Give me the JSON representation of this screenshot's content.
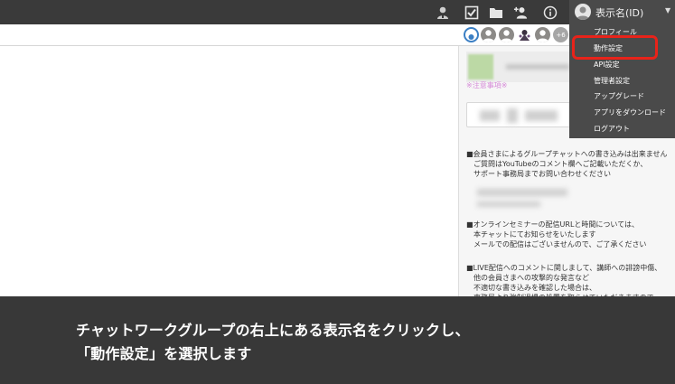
{
  "topbar": {
    "icons": [
      "admin-icon",
      "task-icon",
      "folder-icon",
      "add-contact-icon",
      "info-icon"
    ],
    "user": {
      "name": "表示名(ID)"
    }
  },
  "room": {
    "member_more": "+6"
  },
  "right_panel": {
    "notice": "※注意事項※",
    "para1": [
      "■会員さまによるグループチャットへの書き込みは出来ません",
      "　ご質問はYouTubeのコメント欄へご記載いただくか、",
      "　サポート事務局までお問い合わせください"
    ],
    "para2": [
      "■オンラインセミナーの配信URLと時間については、",
      "　本チャットにてお知らせをいたします",
      "　メールでの配信はございませんので、ご了承ください"
    ],
    "para3": [
      "■LIVE配信へのコメントに関しまして、講師への誹謗中傷、",
      "　他の会員さまへの攻撃的な発言など",
      "　不適切な書き込みを確認した場合は、",
      "　事務局より強制退場の処置を取らせていただきますので"
    ]
  },
  "dropdown": {
    "items": [
      "プロフィール",
      "動作設定",
      "API設定",
      "管理者設定",
      "アップグレード",
      "アプリをダウンロード",
      "ログアウト"
    ],
    "highlight_color": "#e8231a"
  },
  "caption": {
    "line1": "チャットワークグループの右上にある表示名をクリックし、",
    "line2": "「動作設定」を選択します"
  }
}
